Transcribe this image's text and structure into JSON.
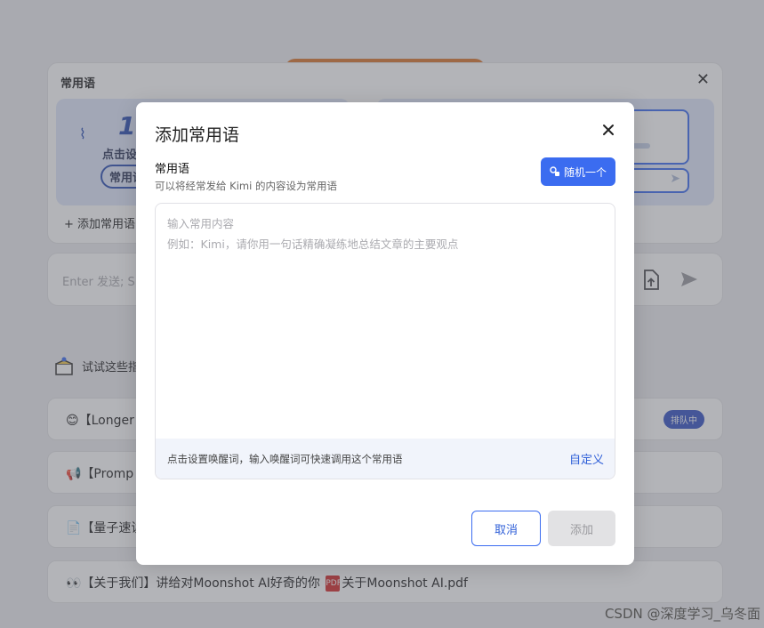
{
  "background": {
    "phrases_panel": {
      "title": "常用语",
      "hint_number": "1",
      "hint_line1": "点击设",
      "hint_line2": "常用语",
      "add_label": "+ 添加常用语"
    },
    "chat_input": {
      "placeholder": "Enter 发送; S"
    },
    "try_title": "试试这些指",
    "list_items": [
      {
        "icon": "😊",
        "text": "【Longer",
        "badge": "排队中"
      },
      {
        "icon": "📢",
        "text": "【Promp"
      },
      {
        "icon": "📄",
        "text": "【量子速读"
      },
      {
        "icon": "👀",
        "text": "【关于我们】讲给对Moonshot AI好奇的你",
        "pdf_icon": "PDF",
        "attachment": "关于Moonshot AI.pdf"
      }
    ],
    "watermark": "CSDN @深度学习_乌冬面"
  },
  "modal": {
    "title": "添加常用语",
    "field_label": "常用语",
    "field_desc": "可以将经常发给 Kimi 的内容设为常用语",
    "random_button": "随机一个",
    "textarea_placeholder_line1": "输入常用内容",
    "textarea_placeholder_line2": "例如：Kimi，请你用一句话精确凝练地总结文章的主要观点",
    "wake_hint": "点击设置唤醒词，输入唤醒词可快速调用这个常用语",
    "wake_link": "自定义",
    "cancel_button": "取消",
    "add_button": "添加"
  },
  "colors": {
    "accent": "#3b6cf0",
    "link": "#2f5fd8",
    "disabled_bg": "#e2e2e4",
    "overlay": "rgba(90,92,100,0.46)"
  }
}
